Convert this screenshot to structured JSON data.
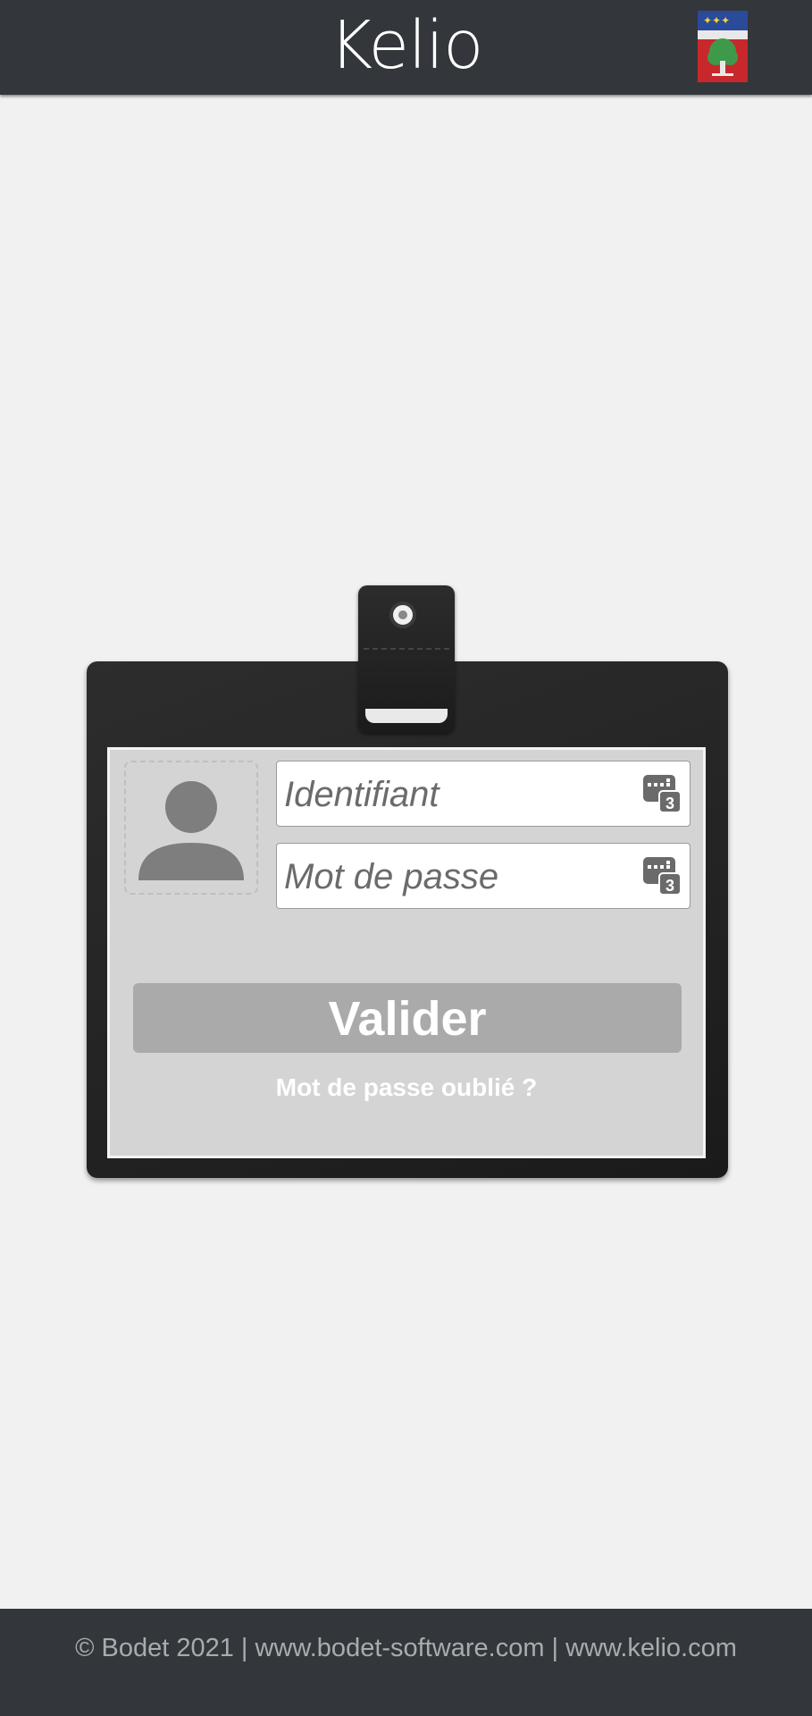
{
  "header": {
    "logo_text": "Kelio",
    "crest_icon": "city-crest-icon"
  },
  "login": {
    "identifier_placeholder": "Identifiant",
    "password_placeholder": "Mot de passe",
    "validate_label": "Valider",
    "forgot_password_label": "Mot de passe oublié ?",
    "avatar_icon": "user-silhouette-icon",
    "virtual_keyboard_icon": "virtual-keypad-icon"
  },
  "footer": {
    "copyright": "© Bodet 2021 | www.bodet-software.com | www.kelio.com"
  },
  "colors": {
    "header_bg": "#33373b",
    "page_bg": "#f1f1f1",
    "badge_bg": "#232323",
    "card_bg": "#d4d4d4",
    "button_bg": "#aaaaaa"
  }
}
